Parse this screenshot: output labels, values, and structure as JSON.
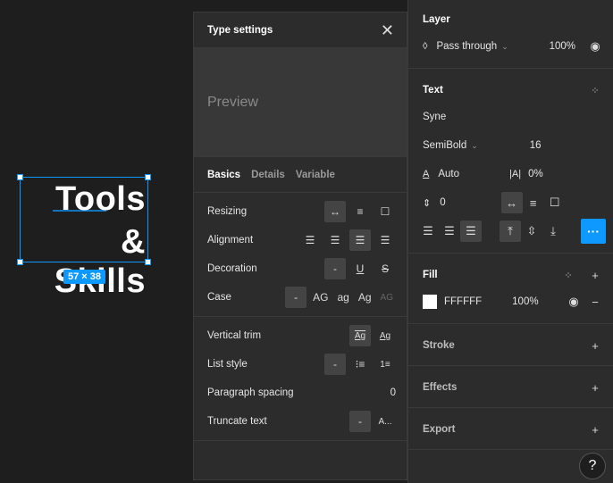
{
  "canvas": {
    "line1": "Tools",
    "line2": "& Skills",
    "size_badge": "57 × 38"
  },
  "type_settings": {
    "title": "Type settings",
    "preview_text": "Preview",
    "tabs": [
      "Basics",
      "Details",
      "Variable"
    ],
    "rows": {
      "resizing": "Resizing",
      "alignment": "Alignment",
      "decoration": "Decoration",
      "case": "Case",
      "vertical_trim": "Vertical trim",
      "list_style": "List style",
      "paragraph_spacing": "Paragraph spacing",
      "truncate_text": "Truncate text"
    },
    "case_options": [
      "-",
      "AG",
      "ag",
      "Ag",
      "AG"
    ],
    "paragraph_spacing_value": "0",
    "truncate_options": [
      "-",
      "A..."
    ],
    "decoration_none": "-",
    "list_none": "-"
  },
  "properties": {
    "layer": {
      "title": "Layer",
      "blend_mode": "Pass through",
      "opacity": "100%"
    },
    "text": {
      "title": "Text",
      "font": "Syne",
      "weight": "SemiBold",
      "size": "16",
      "line_height": "Auto",
      "letter_spacing": "0%",
      "paragraph": "0",
      "more": "···"
    },
    "fill": {
      "title": "Fill",
      "hex": "FFFFFF",
      "opacity": "100%",
      "color": "#ffffff"
    },
    "stroke": {
      "title": "Stroke"
    },
    "effects": {
      "title": "Effects"
    },
    "export": {
      "title": "Export"
    },
    "help": "?"
  }
}
